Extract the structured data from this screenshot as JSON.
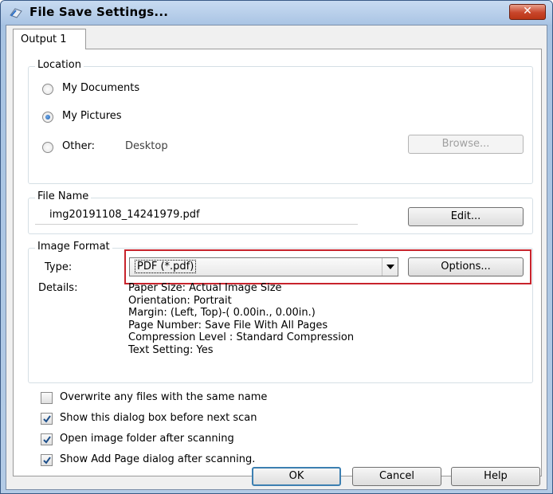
{
  "window": {
    "title": "File Save Settings...",
    "close_label": "✕"
  },
  "tab": {
    "label": "Output 1"
  },
  "location": {
    "title": "Location",
    "options": [
      {
        "label": "My Documents",
        "checked": false
      },
      {
        "label": "My Pictures",
        "checked": true
      },
      {
        "label": "Other:",
        "checked": false
      }
    ],
    "other_value": "Desktop",
    "browse_label": "Browse..."
  },
  "file_name": {
    "title": "File Name",
    "value": "img20191108_14241979.pdf",
    "edit_label": "Edit..."
  },
  "image_format": {
    "title": "Image Format",
    "type_label": "Type:",
    "type_value": "PDF (*.pdf)",
    "options_label": "Options...",
    "details_label": "Details:",
    "details": [
      "Paper Size: Actual Image Size",
      "Orientation: Portrait",
      "Margin: (Left, Top)-( 0.00in., 0.00in.)",
      "Page Number: Save File With All Pages",
      "Compression Level : Standard Compression",
      "Text Setting: Yes"
    ]
  },
  "checkboxes": [
    {
      "label": "Overwrite any files with the same name",
      "checked": false
    },
    {
      "label": "Show this dialog box before next scan",
      "checked": true
    },
    {
      "label": "Open image folder after scanning",
      "checked": true
    },
    {
      "label": "Show Add Page dialog after scanning.",
      "checked": true
    }
  ],
  "footer": {
    "ok_label": "OK",
    "cancel_label": "Cancel",
    "help_label": "Help"
  },
  "colors": {
    "highlight": "#c8232c",
    "title_bar": "#a9c4e4",
    "close_button": "#c8452a"
  }
}
